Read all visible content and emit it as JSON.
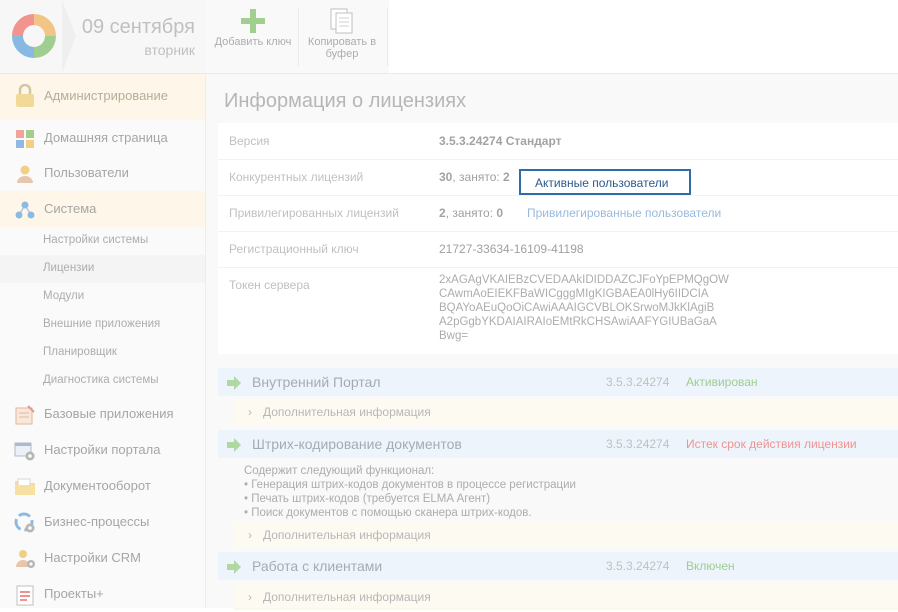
{
  "header": {
    "date_day": "09 сентября",
    "date_weekday": "вторник",
    "toolbar": [
      {
        "icon": "plus-icon",
        "label": "Добавить ключ"
      },
      {
        "icon": "copy-icon",
        "label": "Копировать в буфер"
      }
    ]
  },
  "sidebar": {
    "items": [
      {
        "label": "Администрирование",
        "icon": "lock-icon"
      },
      {
        "label": "Домашняя страница",
        "icon": "tiles-icon"
      },
      {
        "label": "Пользователи",
        "icon": "user-icon"
      },
      {
        "label": "Система",
        "icon": "network-icon"
      }
    ],
    "sub_items": [
      {
        "label": "Настройки системы"
      },
      {
        "label": "Лицензии"
      },
      {
        "label": "Модули"
      },
      {
        "label": "Внешние приложения"
      },
      {
        "label": "Планировщик"
      },
      {
        "label": "Диагностика системы"
      }
    ],
    "items2": [
      {
        "label": "Базовые приложения",
        "icon": "apps-icon"
      },
      {
        "label": "Настройки портала",
        "icon": "portal-settings-icon"
      },
      {
        "label": "Документооборот",
        "icon": "folder-icon"
      },
      {
        "label": "Бизнес-процессы",
        "icon": "process-icon"
      },
      {
        "label": "Настройки CRM",
        "icon": "crm-icon"
      },
      {
        "label": "Проекты+",
        "icon": "projects-icon"
      }
    ]
  },
  "main": {
    "title": "Информация о лицензиях",
    "rows": {
      "version": {
        "key": "Версия",
        "value": "3.5.3.24274 Стандарт"
      },
      "concurrent": {
        "key": "Конкурентных лицензий",
        "total": "30",
        "busy_label": ", занято: ",
        "busy": "2",
        "link": "Активные пользователи"
      },
      "privileged": {
        "key": "Привилегированных лицензий",
        "total": "2",
        "busy_label": ", занято: ",
        "busy": "0",
        "link": "Привилегированные пользователи"
      },
      "regkey": {
        "key": "Регистрационный ключ",
        "value": "21727-33634-16109-41198"
      },
      "token": {
        "key": "Токен сервера",
        "lines": [
          "2xAGAgVKAIEBzCVEDAAkIDIDDAZCJFoYpEPMQgOW",
          "CAwmAoEIEKFBaWICgggMIgKIGBAEA0lHy6IIDCIA",
          "BQAYoAEuQoOiCAwiAAAIGCVBLOKSrwoMJkKlAgiB",
          "A2pGgbYKDAIAIRAIoEMtRkCHSAwiAAFYGIUBaGaA",
          "Bwg="
        ]
      }
    },
    "modules": [
      {
        "name": "Внутренний Портал",
        "version": "3.5.3.24274",
        "status": "Активирован",
        "status_color": "#5fae4e",
        "extra": "Дополнительная информация"
      },
      {
        "name": "Штрих-кодирование документов",
        "version": "3.5.3.24274",
        "status": "Истек срок действия лицензии",
        "status_color": "#e2524e",
        "extra": "Дополнительная информация",
        "desc": [
          "Содержит следующий функционал:",
          "• Генерация штрих-кодов документов в процессе регистрации",
          "• Печать штрих-кодов (требуется ELMA Агент)",
          "• Поиск документов с помощью сканера штрих-кодов."
        ]
      },
      {
        "name": "Работа с клиентами",
        "version": "3.5.3.24274",
        "status": "Включен",
        "status_color": "#5fae4e",
        "extra": "Дополнительная информация"
      }
    ]
  },
  "colors": {
    "accent": "#2e6ea8",
    "module_head": "#e4edf8",
    "selected_nav": "#fdf3dc"
  }
}
